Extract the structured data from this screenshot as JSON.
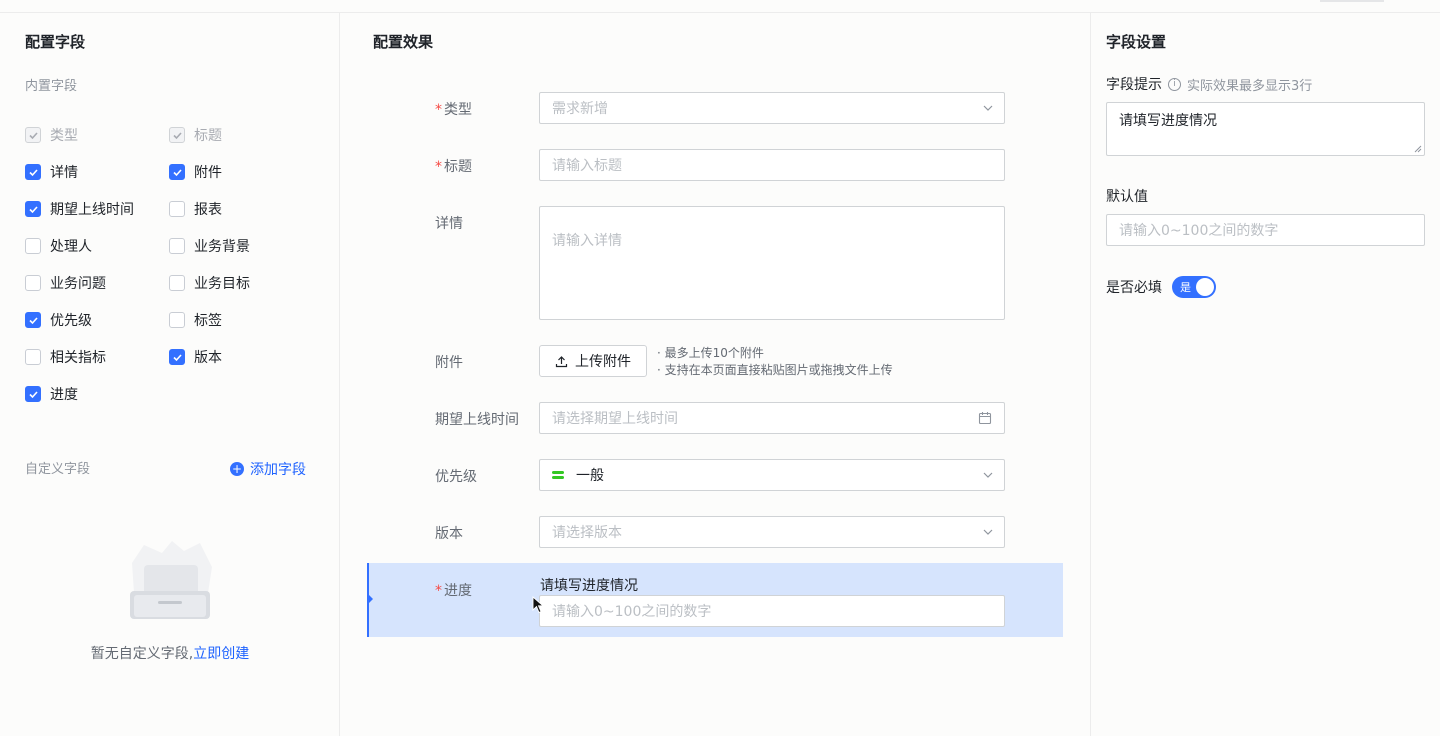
{
  "left": {
    "title": "配置字段",
    "builtin_label": "内置字段",
    "fields": [
      {
        "label": "类型",
        "checked": true,
        "disabled": true
      },
      {
        "label": "标题",
        "checked": true,
        "disabled": true
      },
      {
        "label": "详情",
        "checked": true,
        "disabled": false
      },
      {
        "label": "附件",
        "checked": true,
        "disabled": false
      },
      {
        "label": "期望上线时间",
        "checked": true,
        "disabled": false
      },
      {
        "label": "报表",
        "checked": false,
        "disabled": false
      },
      {
        "label": "处理人",
        "checked": false,
        "disabled": false
      },
      {
        "label": "业务背景",
        "checked": false,
        "disabled": false
      },
      {
        "label": "业务问题",
        "checked": false,
        "disabled": false
      },
      {
        "label": "业务目标",
        "checked": false,
        "disabled": false
      },
      {
        "label": "优先级",
        "checked": true,
        "disabled": false
      },
      {
        "label": "标签",
        "checked": false,
        "disabled": false
      },
      {
        "label": "相关指标",
        "checked": false,
        "disabled": false
      },
      {
        "label": "版本",
        "checked": true,
        "disabled": false
      },
      {
        "label": "进度",
        "checked": true,
        "disabled": false
      }
    ],
    "custom_label": "自定义字段",
    "add_field": "添加字段",
    "empty_text": "暂无自定义字段,",
    "create_now": "立即创建"
  },
  "middle": {
    "title": "配置效果",
    "type_label": "类型",
    "type_value": "需求新增",
    "title_label": "标题",
    "title_placeholder": "请输入标题",
    "detail_label": "详情",
    "detail_placeholder": "请输入详情",
    "attachment_label": "附件",
    "upload_button": "上传附件",
    "upload_hint_1": "· 最多上传10个附件",
    "upload_hint_2": "· 支持在本页面直接粘贴图片或拖拽文件上传",
    "release_label": "期望上线时间",
    "release_placeholder": "请选择期望上线时间",
    "priority_label": "优先级",
    "priority_value": "一般",
    "version_label": "版本",
    "version_placeholder": "请选择版本",
    "progress_label": "进度",
    "progress_hint": "请填写进度情况",
    "progress_placeholder": "请输入0~100之间的数字"
  },
  "right": {
    "title": "字段设置",
    "hint_label": "字段提示",
    "hint_info": "实际效果最多显示3行",
    "hint_value": "请填写进度情况",
    "default_label": "默认值",
    "default_placeholder": "请输入0~100之间的数字",
    "required_label": "是否必填",
    "required_toggle": "是",
    "required_on": true
  },
  "colors": {
    "accent": "#3370ff",
    "required": "#f54a45",
    "priority_normal": "#34c724",
    "selected_bg": "#d6e4fd"
  }
}
